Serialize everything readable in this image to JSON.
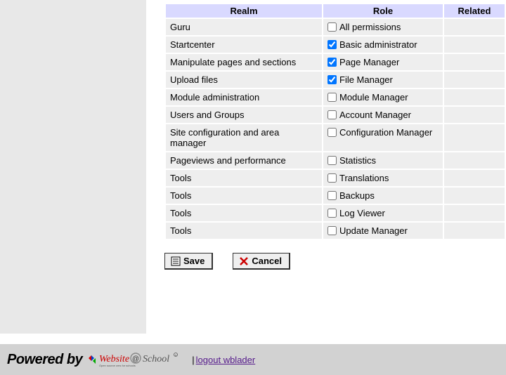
{
  "table": {
    "headers": {
      "realm": "Realm",
      "role": "Role",
      "related": "Related"
    },
    "rows": [
      {
        "realm": "Guru",
        "role": "All permissions",
        "checked": false
      },
      {
        "realm": "Startcenter",
        "role": "Basic administrator",
        "checked": true
      },
      {
        "realm": "Manipulate pages and sections",
        "role": "Page Manager",
        "checked": true
      },
      {
        "realm": "Upload files",
        "role": "File Manager",
        "checked": true
      },
      {
        "realm": "Module administration",
        "role": "Module Manager",
        "checked": false
      },
      {
        "realm": "Users and Groups",
        "role": "Account Manager",
        "checked": false
      },
      {
        "realm": "Site configuration and area manager",
        "role": "Configuration Manager",
        "checked": false
      },
      {
        "realm": "Pageviews and performance",
        "role": "Statistics",
        "checked": false
      },
      {
        "realm": "Tools",
        "role": "Translations",
        "checked": false
      },
      {
        "realm": "Tools",
        "role": "Backups",
        "checked": false
      },
      {
        "realm": "Tools",
        "role": "Log Viewer",
        "checked": false
      },
      {
        "realm": "Tools",
        "role": "Update Manager",
        "checked": false
      }
    ]
  },
  "buttons": {
    "save": "Save",
    "cancel": "Cancel"
  },
  "footer": {
    "powered_by": "Powered by",
    "logout_label": "logout wblader"
  }
}
